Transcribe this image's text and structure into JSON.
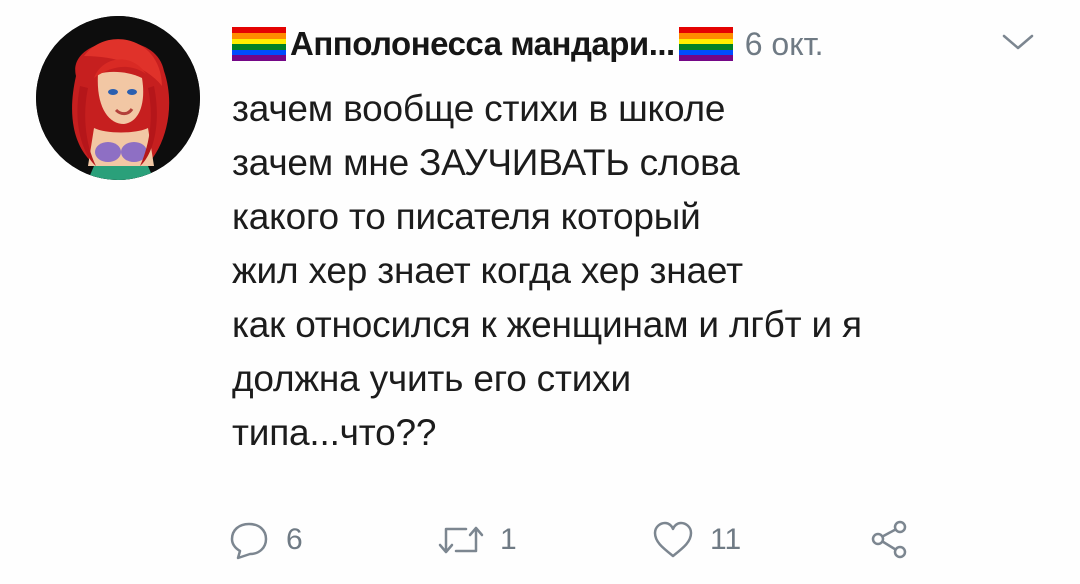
{
  "tweet": {
    "display_name": "Апполонесса мандари...",
    "timestamp": "6 окт.",
    "body_lines": [
      "зачем вообще стихи в школе",
      "зачем мне ЗАУЧИВАТЬ слова",
      "какого то писателя который",
      "жил хер знает когда хер знает",
      "как относился к женщинам и лгбт и я",
      "должна учить его стихи",
      "типа...что??"
    ],
    "actions": {
      "reply_count": "6",
      "retweet_count": "1",
      "like_count": "11"
    }
  },
  "icons": {
    "name_prefix": "rainbow-flag-icon",
    "name_suffix": "rainbow-flag-icon",
    "menu": "chevron-down-icon",
    "reply": "reply-icon",
    "retweet": "retweet-icon",
    "like": "heart-icon",
    "share": "share-icon"
  },
  "colors": {
    "text": "#1c1c1c",
    "muted": "#6f7a84",
    "background": "#fefefe",
    "rainbow": [
      "#e40303",
      "#ff8c00",
      "#ffed00",
      "#008026",
      "#004dff",
      "#750787"
    ]
  }
}
